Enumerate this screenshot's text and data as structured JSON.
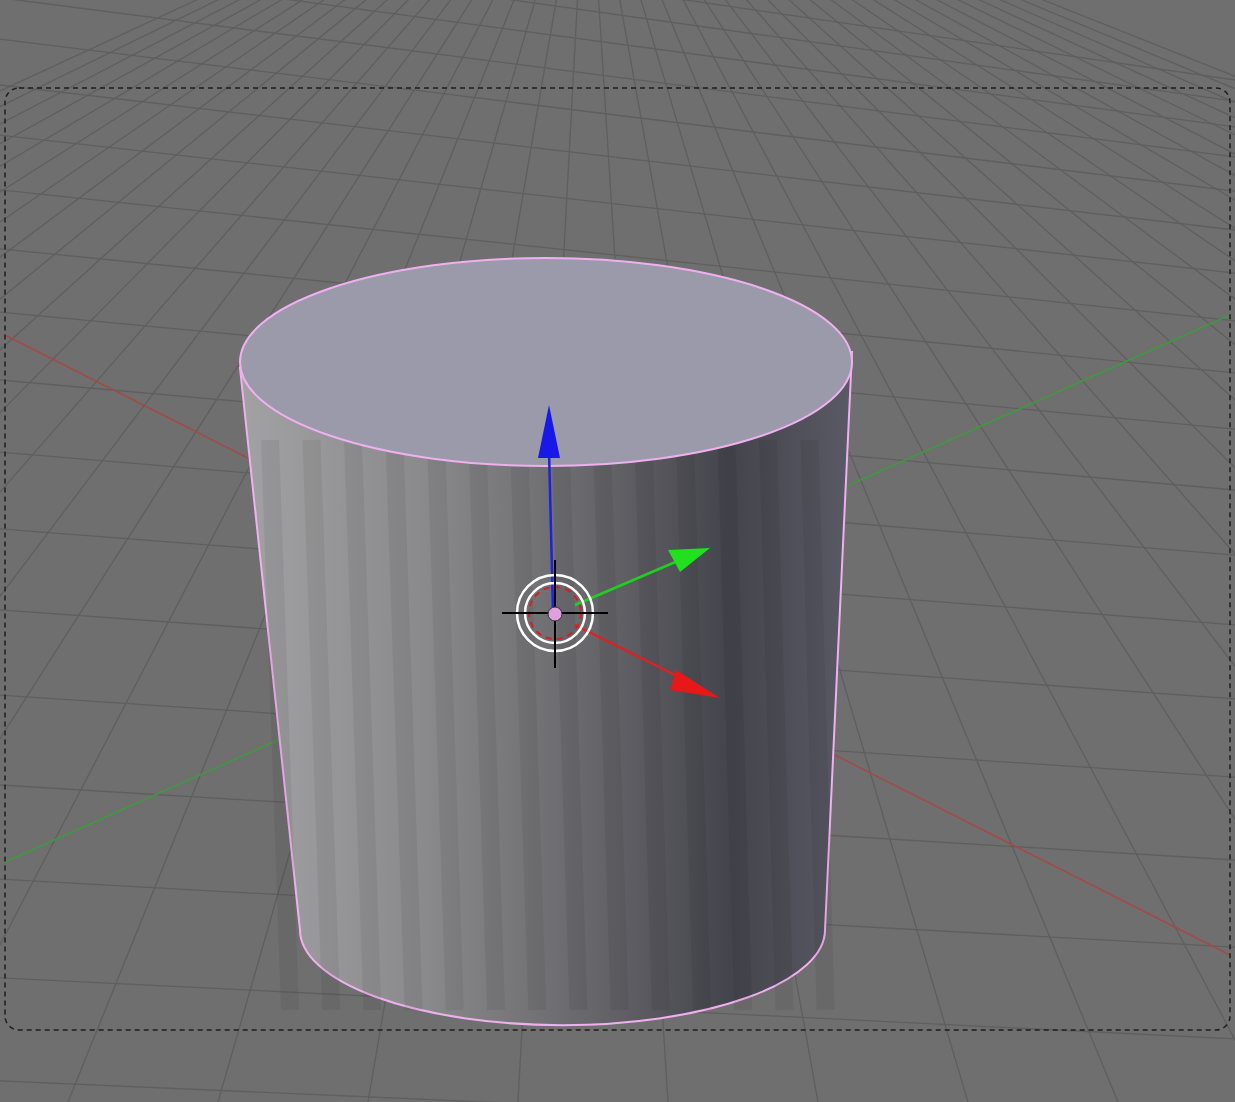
{
  "viewport": {
    "objects": [
      {
        "kind": "cylinder",
        "selected": true
      }
    ]
  }
}
